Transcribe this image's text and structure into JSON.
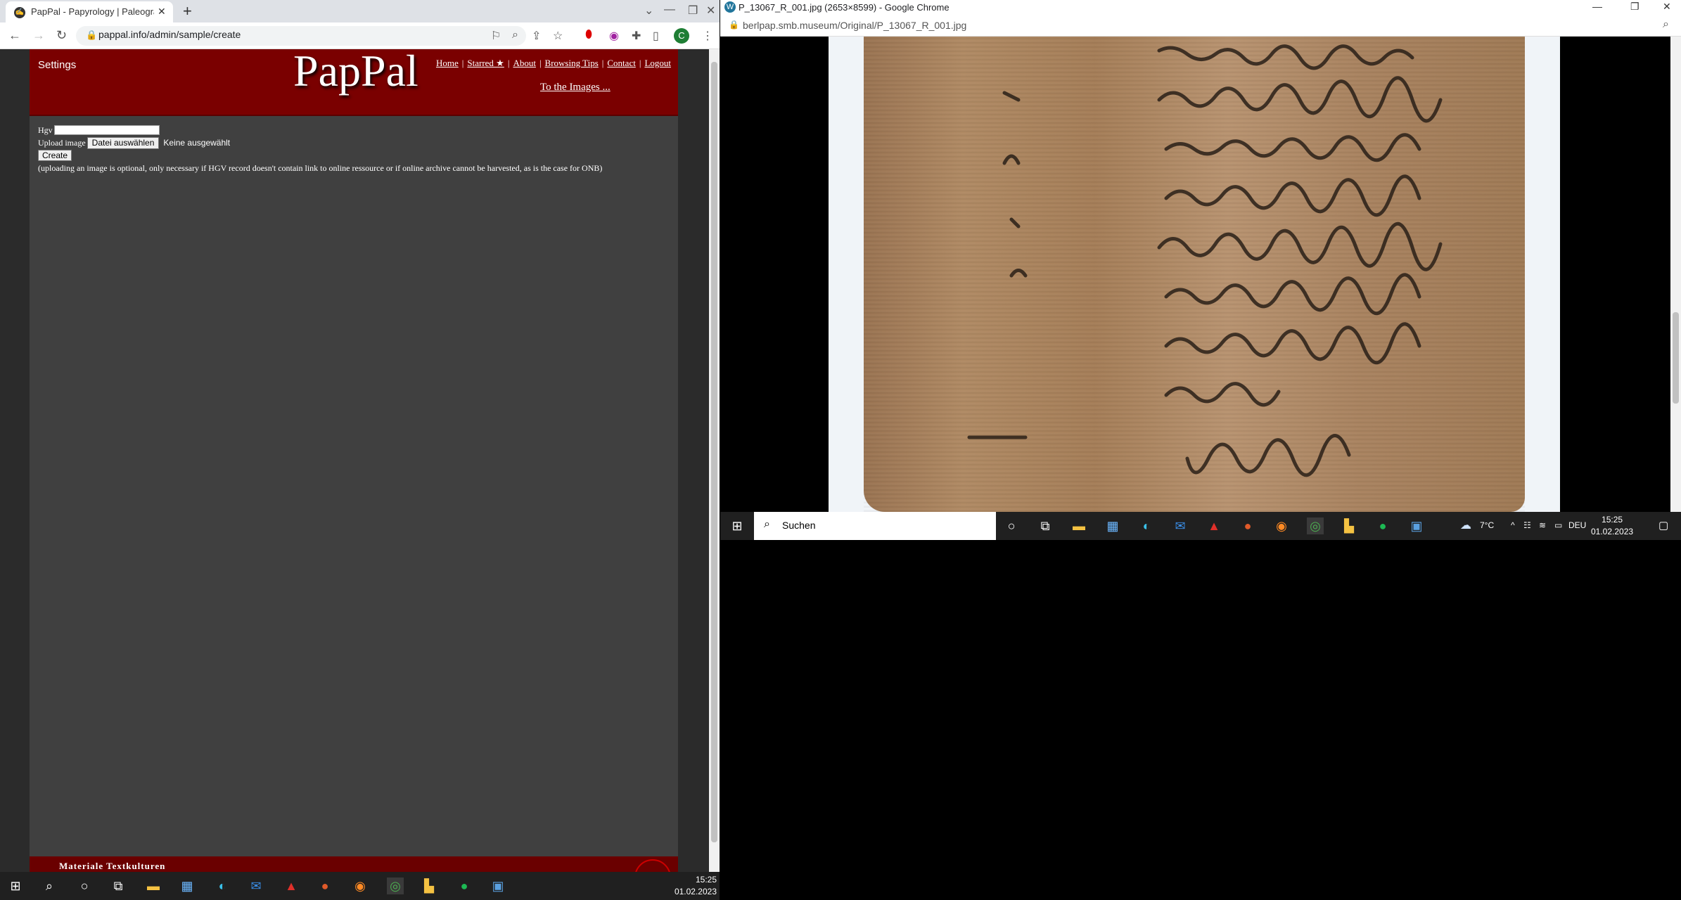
{
  "left_window": {
    "tab_title": "PapPal - Papyrology | Paleograph",
    "url": "pappal.info/admin/sample/create",
    "profile_initial": "C"
  },
  "page": {
    "settings": "Settings",
    "logo": "PapPal",
    "nav": [
      "Home",
      "Starred ★",
      "About",
      "Browsing Tips",
      "Contact",
      "Logout"
    ],
    "to_images": "To the Images ...",
    "form": {
      "hgv_label": "Hgv",
      "upload_label": "Upload image",
      "file_button": "Datei auswählen",
      "no_file": "Keine ausgewählt",
      "create_button": "Create",
      "note": "(uploading an image is optional, only necessary if HGV record doesn't contain link to online ressource or if online archive cannot be harvested, as is the case for ONB)"
    },
    "footer_text": "Materiale Textkulturen"
  },
  "left_taskbar": {
    "time": "15:25",
    "date": "01.02.2023"
  },
  "right_window": {
    "title": "P_13067_R_001.jpg (2653×8599) - Google Chrome",
    "url": "berlpap.smb.museum/Original/P_13067_R_001.jpg"
  },
  "right_taskbar": {
    "search_placeholder": "Suchen",
    "weather": "7°C",
    "language": "DEU",
    "time": "15:25",
    "date": "01.02.2023"
  }
}
